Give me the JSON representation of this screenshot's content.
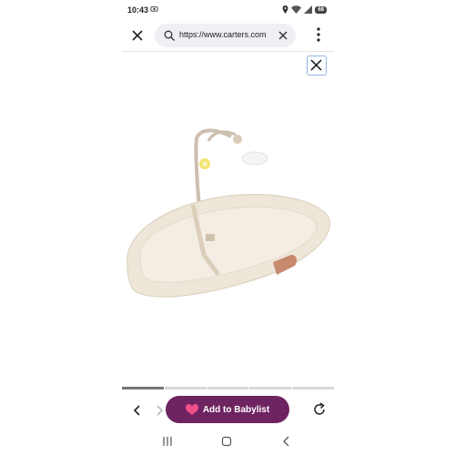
{
  "status": {
    "time": "10:43",
    "battery": "68"
  },
  "browser": {
    "url": "https://www.carters.com",
    "tabs_visible": 5,
    "active_gallery_index": 0
  },
  "action": {
    "add_label": "Add to Babylist"
  },
  "colors": {
    "babylist_bg": "#6e2461",
    "heart": "#f2508a",
    "focus_border": "#8fb5e6"
  },
  "icons": [
    "close-icon",
    "search-icon",
    "clear-icon",
    "more-vert-icon",
    "back-icon",
    "forward-icon",
    "heart-icon",
    "reload-icon",
    "recent-apps-icon",
    "home-icon",
    "system-back-icon"
  ]
}
